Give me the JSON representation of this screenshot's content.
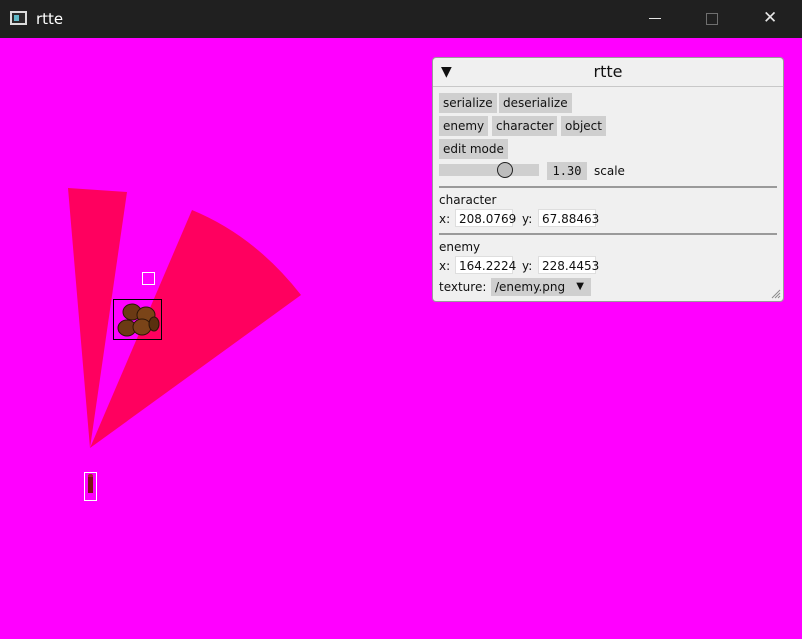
{
  "window": {
    "title": "rtte",
    "icon": "app-icon",
    "background_color": "#ff00ff",
    "controls": {
      "minimize": "minimize-icon",
      "maximize": "maximize-icon",
      "close": "✕"
    }
  },
  "scene": {
    "cone_color": "#ff005f",
    "character_sprite": "character-sprite",
    "object_sprite": "barrels-sprite"
  },
  "panel": {
    "title": "rtte",
    "collapse_glyph": "▼",
    "buttons": {
      "serialize": "serialize",
      "deserialize": "deserialize",
      "enemy": "enemy",
      "character": "character",
      "object": "object",
      "edit_mode": "edit mode"
    },
    "scale": {
      "value": "1.30",
      "label": "scale"
    },
    "character": {
      "heading": "character",
      "x_label": "x:",
      "x": "208.0769",
      "y_label": "y:",
      "y": "67.88463"
    },
    "enemy": {
      "heading": "enemy",
      "x_label": "x:",
      "x": "164.2224",
      "y_label": "y:",
      "y": "228.4453",
      "texture_label": "texture:",
      "texture": "/enemy.png"
    }
  }
}
